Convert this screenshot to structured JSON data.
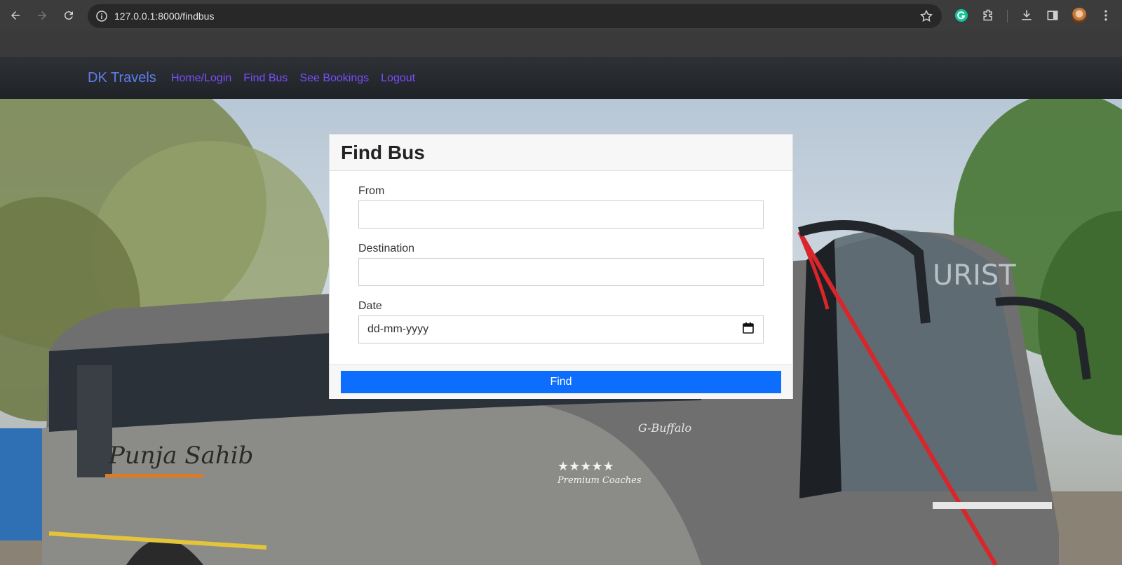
{
  "browser": {
    "url": "127.0.0.1:8000/findbus"
  },
  "navbar": {
    "brand": "DK Travels",
    "links": [
      "Home/Login",
      "Find Bus",
      "See Bookings",
      "Logout"
    ]
  },
  "form": {
    "title": "Find Bus",
    "fields": [
      {
        "label": "From",
        "value": ""
      },
      {
        "label": "Destination",
        "value": ""
      },
      {
        "label": "Date",
        "value": "dd-mm-yyyy"
      }
    ],
    "submit_label": "Find"
  },
  "background": {
    "bus_name": "Punja Sahib",
    "bus_badge": "Premium Coaches",
    "bus_model": "G-Buffalo",
    "windshield_text": "URIST"
  },
  "colors": {
    "brand": "#5f7cf0",
    "nav_link": "#7c4dff",
    "primary_button": "#0d6efd"
  },
  "icons": [
    "back-icon",
    "forward-icon",
    "reload-icon",
    "site-info-icon",
    "bookmark-star-icon",
    "grammarly-icon",
    "extensions-icon",
    "download-icon",
    "side-panel-icon",
    "menu-icon",
    "calendar-icon"
  ]
}
